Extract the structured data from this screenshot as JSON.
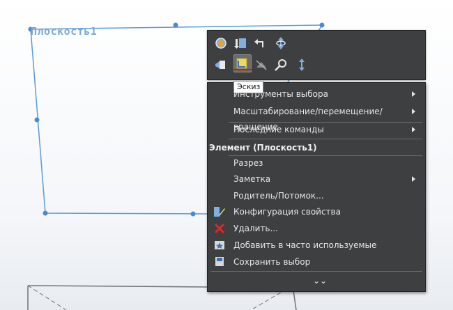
{
  "plane": {
    "label": "Плоскость1"
  },
  "tooltip": {
    "text": "Эскиз"
  },
  "toolbar": {
    "row1": [
      "rotate-view-icon",
      "edit-feature-icon",
      "undo-arrow-icon",
      "move-icon"
    ],
    "row2": [
      "sketch-view-icon",
      "sketch-icon",
      "hide-icon",
      "zoom-icon",
      "normal-to-icon"
    ]
  },
  "menu": {
    "items_top": [
      {
        "label": "Инструменты выбора",
        "submenu": true
      },
      {
        "label": "Масштабирование/перемещение/вращение",
        "submenu": true
      },
      {
        "label": "Последние команды",
        "submenu": true
      }
    ],
    "section_title": "Элемент (Плоскость1)",
    "items_bottom": [
      {
        "label": "Разрез",
        "submenu": false
      },
      {
        "label": "Заметка",
        "submenu": true
      },
      {
        "label": "Родитель/Потомок...",
        "submenu": false
      },
      {
        "label": "Конфигурация свойства",
        "submenu": false
      },
      {
        "label": "Удалить...",
        "submenu": false
      },
      {
        "label": "Добавить в часто используемые",
        "submenu": false
      },
      {
        "label": "Сохранить выбор",
        "submenu": false
      }
    ]
  },
  "colors": {
    "plane_edge": "#5b9bd5",
    "menu_bg": "#3d3f41",
    "menu_text": "#e6e6e6",
    "delete_red": "#d92b2b",
    "active_underline": "#d01818"
  }
}
